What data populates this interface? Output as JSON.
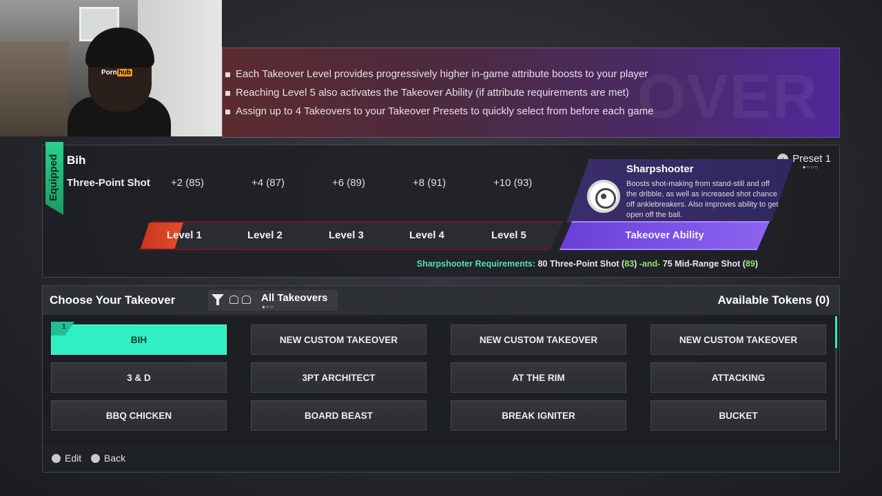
{
  "webcam": {
    "cap_logo_a": "Porn",
    "cap_logo_b": "hub"
  },
  "banner": {
    "bg_word": "OVER",
    "bullets": [
      "Each Takeover Level provides progressively higher in-game attribute boosts to your player",
      "Reaching Level 5 also activates the Takeover Ability (if attribute requirements are met)",
      "Assign up to 4 Takeovers to your Takeover Presets to quickly select from before each game"
    ]
  },
  "detail": {
    "equipped_label": "Equipped",
    "takeover_name": "Bih",
    "attribute": "Three-Point Shot",
    "boosts": [
      "+2 (85)",
      "+4 (87)",
      "+6 (89)",
      "+8 (91)",
      "+10 (93)"
    ],
    "preset_label": "Preset 1",
    "preset_dots": "●○○○",
    "levels": [
      "Level 1",
      "Level 2",
      "Level 3",
      "Level 4",
      "Level 5"
    ],
    "current_level": 1,
    "ability_bar_label": "Takeover Ability",
    "ability": {
      "name": "Sharpshooter",
      "description": "Boosts shot-making from stand-still and off the dribble, as well as increased shot chance off anklebreakers. Also improves ability to get open off the ball."
    },
    "requirements": {
      "label": "Sharpshooter Requirements:",
      "req1_text": "80 Three-Point Shot (",
      "req1_value": "83",
      "req1_close": ")",
      "joiner": " -and- ",
      "req2_text": "75 Mid-Range Shot (",
      "req2_value": "89",
      "req2_close": ")"
    }
  },
  "choose": {
    "title": "Choose Your Takeover",
    "filter_label": "All Takeovers",
    "filter_dots": "●○○",
    "tokens_label": "Available Tokens (0)",
    "selected_badge": "1",
    "takeovers": [
      "BIH",
      "NEW CUSTOM TAKEOVER",
      "NEW CUSTOM TAKEOVER",
      "NEW CUSTOM TAKEOVER",
      "3 & D",
      "3PT ARCHITECT",
      "AT THE RIM",
      "ATTACKING",
      "BBQ CHICKEN",
      "BOARD BEAST",
      "BREAK IGNITER",
      "BUCKET"
    ],
    "selected_index": 0
  },
  "footer": {
    "edit_label": "Edit",
    "back_label": "Back"
  },
  "colors": {
    "accent": "#2ff0c2",
    "ability_purple": "#7b4fe6",
    "level_red": "#d8401f"
  }
}
